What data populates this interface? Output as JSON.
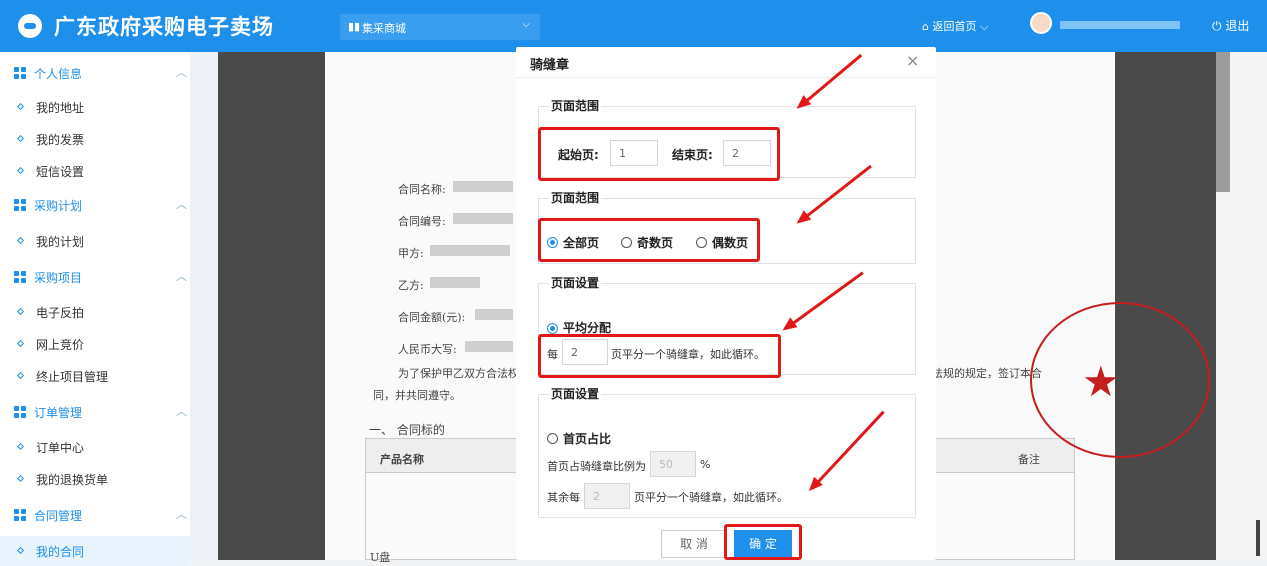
{
  "header": {
    "site_title": "广东政府采购电子卖场",
    "mall_select": "集采商城",
    "home_link": "返回首页",
    "logout": "退出",
    "accent_color": "#1e90ec"
  },
  "sidebar": {
    "groups": [
      {
        "label": "个人信息",
        "items": [
          "我的地址",
          "我的发票",
          "短信设置"
        ]
      },
      {
        "label": "采购计划",
        "items": [
          "我的计划"
        ]
      },
      {
        "label": "采购项目",
        "items": [
          "电子反拍",
          "网上竞价",
          "终止项目管理"
        ]
      },
      {
        "label": "订单管理",
        "items": [
          "订单中心",
          "我的退换货单"
        ]
      },
      {
        "label": "合同管理",
        "items": [
          "我的合同"
        ]
      }
    ]
  },
  "document": {
    "fields": [
      "合同名称:",
      "合同编号:",
      "甲方:",
      "乙方:",
      "合同金额(元):",
      "人民币大写:"
    ],
    "intro": "为了保护甲乙双方合法权",
    "intro_tail": "法规的规定，签订本合",
    "agree": "同，并共同遵守。",
    "section1": "一、 合同标的",
    "col_product": "产品名称",
    "col_remark": "备注",
    "row_product": "U盘"
  },
  "modal": {
    "title": "骑缝章",
    "close": "×",
    "range_legend": "页面范围",
    "start_label": "起始页:",
    "start_value": "1",
    "end_label": "结束页:",
    "end_value": "2",
    "scope_legend": "页面范围",
    "opt_all": "全部页",
    "opt_odd": "奇数页",
    "opt_even": "偶数页",
    "setting_legend": "页面设置",
    "even_split": "平均分配",
    "per_prefix": "每",
    "per_value": "2",
    "per_suffix": "页平分一个骑缝章，如此循环。",
    "setting2_legend": "页面设置",
    "first_ratio": "首页占比",
    "first_ratio_text": "首页占骑缝章比例为",
    "first_ratio_value": "50",
    "percent": "%",
    "rest_prefix": "其余每",
    "rest_value": "2",
    "rest_suffix": "页平分一个骑缝章，如此循环。",
    "cancel": "取 消",
    "confirm": "确 定"
  }
}
